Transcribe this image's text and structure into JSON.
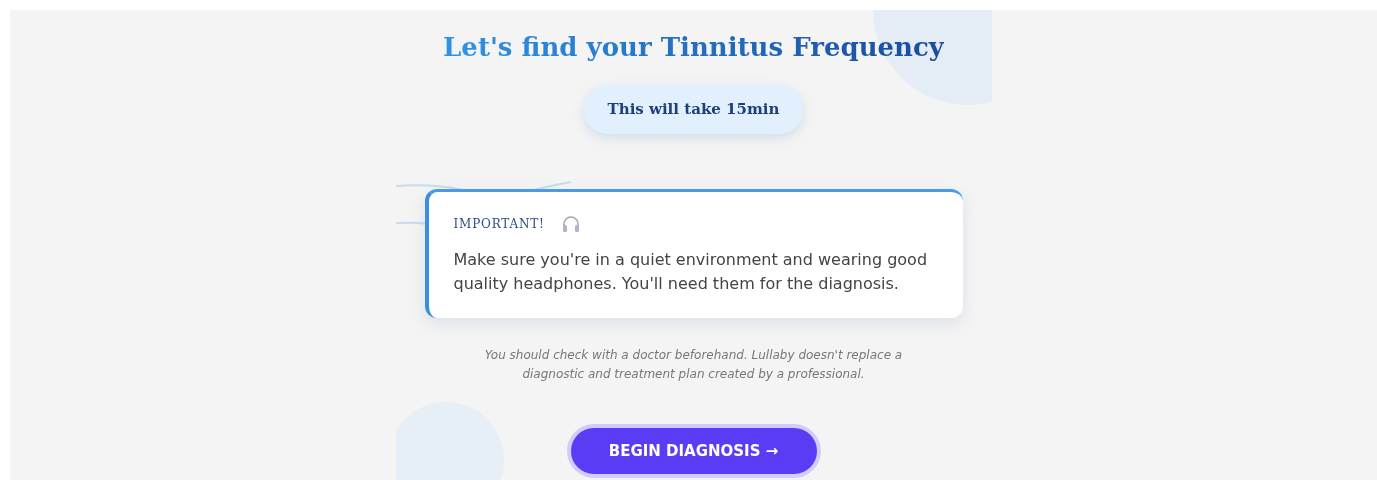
{
  "title": "Let's find your Tinnitus Frequency",
  "duration_badge": "This will take 15min",
  "notice": {
    "label": "IMPORTANT!",
    "text": "Make sure you're in a quiet environment and wearing good quality headphones. You'll need them for the diagnosis."
  },
  "disclaimer": "You should check with a doctor beforehand. Lullaby doesn't replace a diagnostic and treatment plan created by a professional.",
  "button": {
    "label": "BEGIN DIAGNOSIS →"
  }
}
